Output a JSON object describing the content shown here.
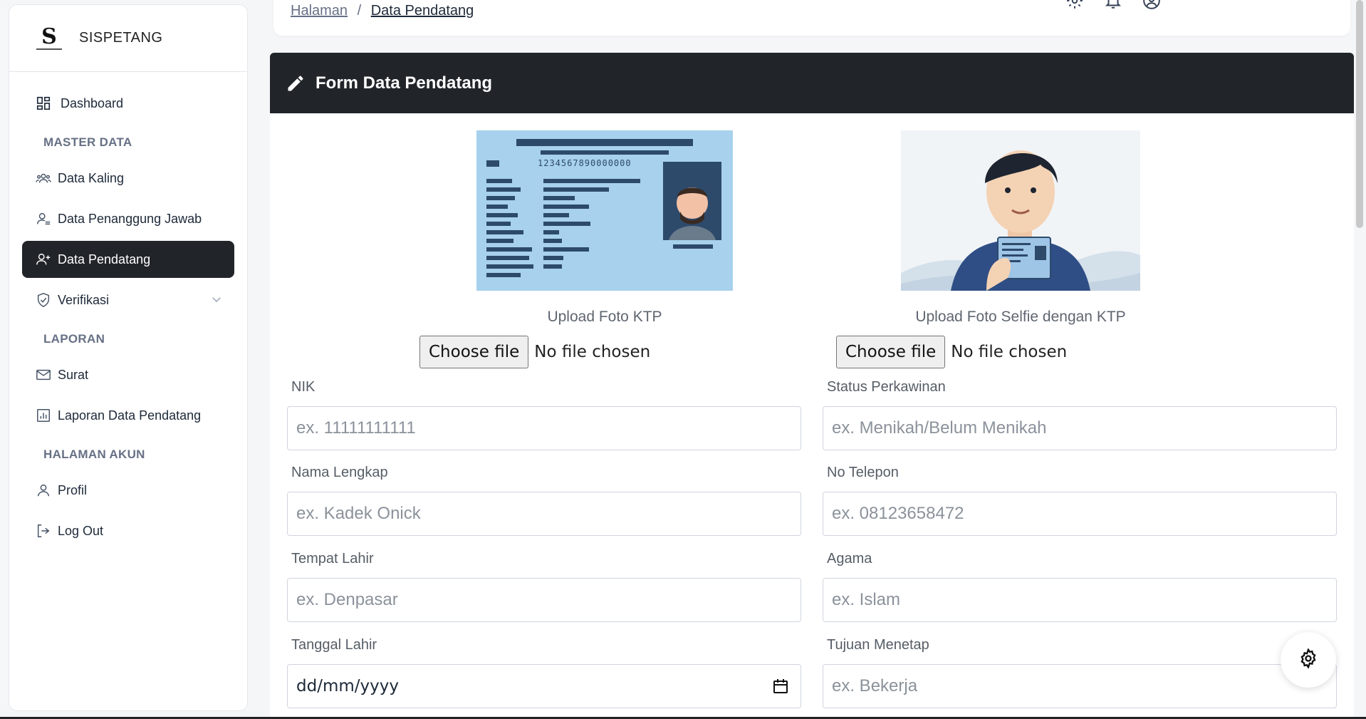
{
  "brand": {
    "name": "SISPETANG",
    "logo_letter": "S"
  },
  "sidebar": {
    "dashboard": "Dashboard",
    "sections": {
      "master": "MASTER DATA",
      "laporan": "LAPORAN",
      "akun": "HALAMAN AKUN"
    },
    "items": [
      {
        "label": "Data Kaling",
        "icon": "users-icon"
      },
      {
        "label": "Data Penanggung Jawab",
        "icon": "user-check-icon"
      },
      {
        "label": "Data Pendatang",
        "icon": "user-plus-icon",
        "active": true
      },
      {
        "label": "Verifikasi",
        "icon": "shield-icon"
      },
      {
        "label": "Surat",
        "icon": "mail-icon"
      },
      {
        "label": "Laporan Data Pendatang",
        "icon": "report-icon"
      },
      {
        "label": "Profil",
        "icon": "user-icon"
      },
      {
        "label": "Log Out",
        "icon": "logout-icon"
      }
    ]
  },
  "topbar": {
    "breadcrumb_root": "Halaman",
    "breadcrumb_sep": "/",
    "breadcrumb_current": "Data Pendatang"
  },
  "form": {
    "title": "Form Data Pendatang",
    "ktp_label": "Upload Foto KTP",
    "ktp_number": "1234567890000000",
    "selfie_label": "Upload Foto Selfie dengan KTP",
    "choose_file": "Choose file",
    "no_file": "No file chosen",
    "fields": {
      "nik": {
        "label": "NIK",
        "placeholder": "ex. 11111111111"
      },
      "status": {
        "label": "Status Perkawinan",
        "placeholder": "ex. Menikah/Belum Menikah"
      },
      "nama": {
        "label": "Nama Lengkap",
        "placeholder": "ex. Kadek Onick"
      },
      "telepon": {
        "label": "No Telepon",
        "placeholder": "ex. 08123658472"
      },
      "tempat": {
        "label": "Tempat Lahir",
        "placeholder": "ex. Denpasar"
      },
      "agama": {
        "label": "Agama",
        "placeholder": "ex. Islam"
      },
      "tanggal": {
        "label": "Tanggal Lahir",
        "value": "dd/mm/yyyy"
      },
      "tujuan": {
        "label": "Tujuan Menetap",
        "placeholder": "ex. Bekerja"
      }
    }
  },
  "colors": {
    "dark": "#212529",
    "accent_ktp": "#a7d1ec"
  }
}
